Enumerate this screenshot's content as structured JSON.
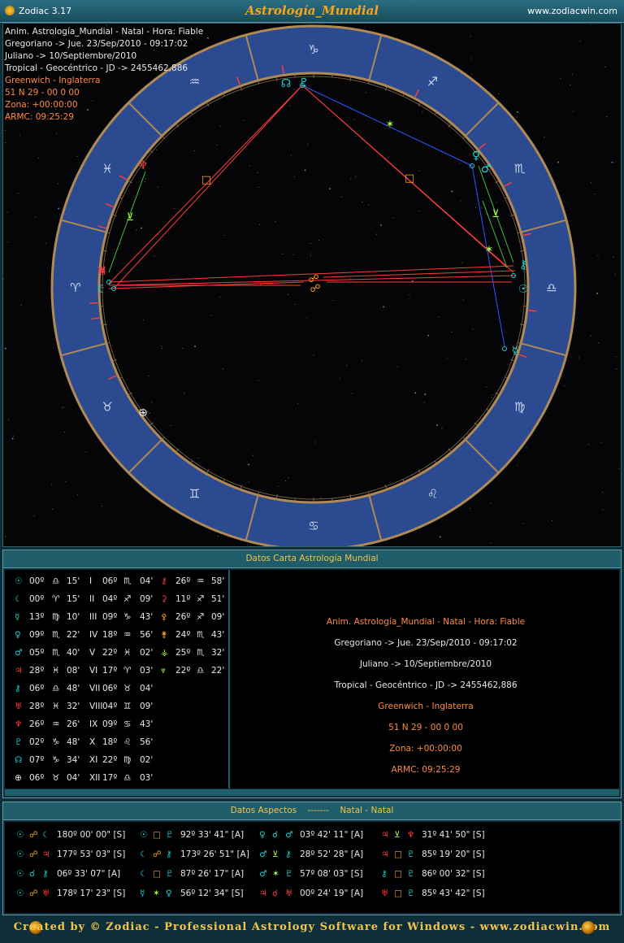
{
  "titlebar": {
    "app_name": "Zodiac 3.17",
    "chart_title": "Astrología_Mundial",
    "website": "www.zodiacwin.com"
  },
  "chart_info": [
    {
      "text": "Anim. Astrología_Mundial - Natal - Hora: Fiable",
      "color": "#e8e8e8"
    },
    {
      "text": "Gregoriano -> Jue. 23/Sep/2010 - 09:17:02",
      "color": "#e8e8e8"
    },
    {
      "text": "Juliano -> 10/Septiembre/2010",
      "color": "#e8e8e8"
    },
    {
      "text": "Tropical - Geocéntrico - JD -> 2455462,886",
      "color": "#e8e8e8"
    },
    {
      "text": "Greenwich - Inglaterra",
      "color": "#ff8a3d"
    },
    {
      "text": "51 N 29 - 00 0 00",
      "color": "#ff8a3d"
    },
    {
      "text": "Zona: +00:00:00",
      "color": "#ff8a3d"
    },
    {
      "text": "ARMC: 09:25:29",
      "color": "#ff8a3d"
    }
  ],
  "wheel": {
    "signs": [
      "♑",
      "♐",
      "♏",
      "♎",
      "♍",
      "♌",
      "♋",
      "♊",
      "♉",
      "♈",
      "♓",
      "♒"
    ],
    "sign_color": "#cfd6ea",
    "ring_color": "#2b4a90",
    "border_color": "#b08a55",
    "planet_glyphs": [
      {
        "name": "north-node",
        "glyph": "☊",
        "color": "#18d4d4"
      },
      {
        "name": "pluto",
        "glyph": "♇",
        "color": "#18d4d4"
      },
      {
        "name": "venus",
        "glyph": "♀",
        "color": "#18d4d4"
      },
      {
        "name": "mars",
        "glyph": "♂",
        "color": "#18d4d4"
      },
      {
        "name": "chiron",
        "glyph": "⚷",
        "color": "#18d4d4"
      },
      {
        "name": "sun",
        "glyph": "☉",
        "color": "#18d4d4"
      },
      {
        "name": "mercury",
        "glyph": "☿",
        "color": "#18d4d4"
      },
      {
        "name": "uranus",
        "glyph": "♅",
        "color": "#ff3b3b"
      },
      {
        "name": "jupiter",
        "glyph": "♃",
        "color": "#ff3b3b"
      },
      {
        "name": "moon",
        "glyph": "☾",
        "color": "#18d4d4"
      },
      {
        "name": "neptune",
        "glyph": "♆",
        "color": "#ff3b3b"
      },
      {
        "name": "part-of-fortune",
        "glyph": "⊕",
        "color": "#e8e8e8"
      }
    ],
    "aspect_glyphs": [
      {
        "name": "square",
        "glyph": "□",
        "color": "#f7a51c"
      },
      {
        "name": "square",
        "glyph": "□",
        "color": "#f7a51c"
      },
      {
        "name": "sextile",
        "glyph": "✶",
        "color": "#a3ff3b"
      },
      {
        "name": "semisextile",
        "glyph": "⊻",
        "color": "#a3ff3b"
      },
      {
        "name": "semisextile",
        "glyph": "⊻",
        "color": "#a3ff3b"
      },
      {
        "name": "sextile",
        "glyph": "✶",
        "color": "#a3ff3b"
      },
      {
        "name": "opposition",
        "glyph": "☍",
        "color": "#f7a51c"
      },
      {
        "name": "opposition",
        "glyph": "☍",
        "color": "#f7a51c"
      }
    ]
  },
  "datos_panel": {
    "title": "Datos Carta Astrología Mundial",
    "positions": [
      {
        "planet": "☉",
        "pcolor": "#18d4d4",
        "deg": "00º",
        "sign": "♎",
        "scolor": "#e8e8e8",
        "min": "15'"
      },
      {
        "planet": "☾",
        "pcolor": "#18d4d4",
        "deg": "00º",
        "sign": "♈",
        "scolor": "#e8e8e8",
        "min": "15'"
      },
      {
        "planet": "☿",
        "pcolor": "#18d4d4",
        "deg": "13º",
        "sign": "♍",
        "scolor": "#e8e8e8",
        "min": "10'"
      },
      {
        "planet": "♀",
        "pcolor": "#18d4d4",
        "deg": "09º",
        "sign": "♏",
        "scolor": "#e8e8e8",
        "min": "22'"
      },
      {
        "planet": "♂",
        "pcolor": "#18d4d4",
        "deg": "05º",
        "sign": "♏",
        "scolor": "#e8e8e8",
        "min": "40'"
      },
      {
        "planet": "♃",
        "pcolor": "#ff3b3b",
        "deg": "28º",
        "sign": "♓",
        "scolor": "#e8e8e8",
        "min": "08'"
      },
      {
        "planet": "⚷",
        "pcolor": "#18d4d4",
        "deg": "06º",
        "sign": "♎",
        "scolor": "#e8e8e8",
        "min": "48'"
      },
      {
        "planet": "♅",
        "pcolor": "#ff3b3b",
        "deg": "28º",
        "sign": "♓",
        "scolor": "#e8e8e8",
        "min": "32'"
      },
      {
        "planet": "♆",
        "pcolor": "#ff3b3b",
        "deg": "26º",
        "sign": "♒",
        "scolor": "#e8e8e8",
        "min": "26'"
      },
      {
        "planet": "♇",
        "pcolor": "#18d4d4",
        "deg": "02º",
        "sign": "♑",
        "scolor": "#e8e8e8",
        "min": "48'"
      },
      {
        "planet": "☊",
        "pcolor": "#18d4d4",
        "deg": "07º",
        "sign": "♑",
        "scolor": "#e8e8e8",
        "min": "34'"
      },
      {
        "planet": "⊕",
        "pcolor": "#e8e8e8",
        "deg": "06º",
        "sign": "♉",
        "scolor": "#e8e8e8",
        "min": "04'"
      }
    ],
    "houses": [
      {
        "num": "I",
        "deg": "06º",
        "sign": "♏",
        "min": "04'"
      },
      {
        "num": "II",
        "deg": "04º",
        "sign": "♐",
        "min": "09'"
      },
      {
        "num": "III",
        "deg": "09º",
        "sign": "♑",
        "min": "43'"
      },
      {
        "num": "IV",
        "deg": "18º",
        "sign": "♒",
        "min": "56'"
      },
      {
        "num": "V",
        "deg": "22º",
        "sign": "♓",
        "min": "02'"
      },
      {
        "num": "VI",
        "deg": "17º",
        "sign": "♈",
        "min": "03'"
      },
      {
        "num": "VII",
        "deg": "06º",
        "sign": "♉",
        "min": "04'"
      },
      {
        "num": "VIII",
        "deg": "04º",
        "sign": "♊",
        "min": "09'"
      },
      {
        "num": "IX",
        "deg": "09º",
        "sign": "♋",
        "min": "43'"
      },
      {
        "num": "X",
        "deg": "18º",
        "sign": "♌",
        "min": "56'"
      },
      {
        "num": "XI",
        "deg": "22º",
        "sign": "♍",
        "min": "02'"
      },
      {
        "num": "XII",
        "deg": "17º",
        "sign": "♎",
        "min": "03'"
      }
    ],
    "asteroids": [
      {
        "glyph": "⚷",
        "gcolor": "#ff3b3b",
        "deg": "26º",
        "sign": "♒",
        "min": "58'"
      },
      {
        "glyph": "⚳",
        "gcolor": "#ff3b3b",
        "deg": "11º",
        "sign": "♐",
        "min": "51'"
      },
      {
        "glyph": "⚴",
        "gcolor": "#f7a51c",
        "deg": "26º",
        "sign": "♐",
        "min": "09'"
      },
      {
        "glyph": "⚵",
        "gcolor": "#f7a51c",
        "deg": "24º",
        "sign": "♏",
        "min": "43'"
      },
      {
        "glyph": "⚶",
        "gcolor": "#a3ff3b",
        "deg": "25º",
        "sign": "♏",
        "min": "32'"
      },
      {
        "glyph": "⩔",
        "gcolor": "#a3ff3b",
        "deg": "22º",
        "sign": "♎",
        "min": "22'"
      }
    ],
    "info_lines": [
      {
        "text": "Anim. Astrología_Mundial - Natal - Hora: Fiable",
        "color": "#ff8a3d"
      },
      {
        "text": "Gregoriano -> Jue. 23/Sep/2010 - 09:17:02",
        "color": "#e8e8e8"
      },
      {
        "text": "Juliano -> 10/Septiembre/2010",
        "color": "#e8e8e8"
      },
      {
        "text": "Tropical - Geocéntrico - JD -> 2455462,886",
        "color": "#e8e8e8"
      },
      {
        "text": "Greenwich - Inglaterra",
        "color": "#ff8a3d"
      },
      {
        "text": "51 N 29 - 00 0 00",
        "color": "#ff8a3d"
      },
      {
        "text": "Zona: +00:00:00",
        "color": "#ff8a3d"
      },
      {
        "text": "ARMC: 09:25:29",
        "color": "#ff8a3d"
      }
    ]
  },
  "aspects_panel": {
    "title_left": "Datos Aspectos",
    "title_sep": "-------",
    "title_right": "Natal - Natal",
    "aspects": [
      {
        "p1": "☉",
        "c1": "#18d4d4",
        "a": "☍",
        "ac": "#f7a51c",
        "p2": "☾",
        "c2": "#18d4d4",
        "val": "180º 00' 00\" [S]"
      },
      {
        "p1": "☉",
        "c1": "#18d4d4",
        "a": "☍",
        "ac": "#f7a51c",
        "p2": "♃",
        "c2": "#ff3b3b",
        "val": "177º 53' 03\" [S]"
      },
      {
        "p1": "☉",
        "c1": "#18d4d4",
        "a": "☌",
        "ac": "#18d4d4",
        "p2": "⚷",
        "c2": "#18d4d4",
        "val": "06º 33' 07\" [A]"
      },
      {
        "p1": "☉",
        "c1": "#18d4d4",
        "a": "☍",
        "ac": "#f7a51c",
        "p2": "♅",
        "c2": "#ff3b3b",
        "val": "178º 17' 23\" [S]"
      },
      {
        "p1": "☉",
        "c1": "#18d4d4",
        "a": "□",
        "ac": "#f7a51c",
        "p2": "♇",
        "c2": "#18d4d4",
        "val": "92º 33' 41\" [A]"
      },
      {
        "p1": "☾",
        "c1": "#18d4d4",
        "a": "☍",
        "ac": "#f7a51c",
        "p2": "⚷",
        "c2": "#18d4d4",
        "val": "173º 26' 51\" [A]"
      },
      {
        "p1": "☾",
        "c1": "#18d4d4",
        "a": "□",
        "ac": "#f7a51c",
        "p2": "♇",
        "c2": "#18d4d4",
        "val": "87º 26' 17\" [A]"
      },
      {
        "p1": "☿",
        "c1": "#18d4d4",
        "a": "✶",
        "ac": "#a3ff3b",
        "p2": "♀",
        "c2": "#18d4d4",
        "val": "56º 12' 34\" [S]"
      },
      {
        "p1": "♀",
        "c1": "#18d4d4",
        "a": "☌",
        "ac": "#18d4d4",
        "p2": "♂",
        "c2": "#18d4d4",
        "val": "03º 42' 11\" [A]"
      },
      {
        "p1": "♂",
        "c1": "#18d4d4",
        "a": "⊻",
        "ac": "#a3ff3b",
        "p2": "⚷",
        "c2": "#18d4d4",
        "val": "28º 52' 28\" [A]"
      },
      {
        "p1": "♂",
        "c1": "#18d4d4",
        "a": "✶",
        "ac": "#a3ff3b",
        "p2": "♇",
        "c2": "#18d4d4",
        "val": "57º 08' 03\" [S]"
      },
      {
        "p1": "♃",
        "c1": "#ff3b3b",
        "a": "☌",
        "ac": "#ff3b3b",
        "p2": "♅",
        "c2": "#ff3b3b",
        "val": "00º 24' 19\" [A]"
      },
      {
        "p1": "♃",
        "c1": "#ff3b3b",
        "a": "⊻",
        "ac": "#a3ff3b",
        "p2": "♆",
        "c2": "#ff3b3b",
        "val": "31º 41' 50\" [S]"
      },
      {
        "p1": "♃",
        "c1": "#ff3b3b",
        "a": "□",
        "ac": "#f7a51c",
        "p2": "♇",
        "c2": "#18d4d4",
        "val": "85º 19' 20\" [S]"
      },
      {
        "p1": "⚷",
        "c1": "#18d4d4",
        "a": "□",
        "ac": "#f7a51c",
        "p2": "♇",
        "c2": "#18d4d4",
        "val": "86º 00' 32\" [S]"
      },
      {
        "p1": "♅",
        "c1": "#ff3b3b",
        "a": "□",
        "ac": "#f7a51c",
        "p2": "♇",
        "c2": "#18d4d4",
        "val": "85º 43' 42\" [S]"
      }
    ]
  },
  "footer": {
    "text": "Created by © Zodiac - Professional Astrology Software for Windows - www.zodiacwin.com"
  }
}
